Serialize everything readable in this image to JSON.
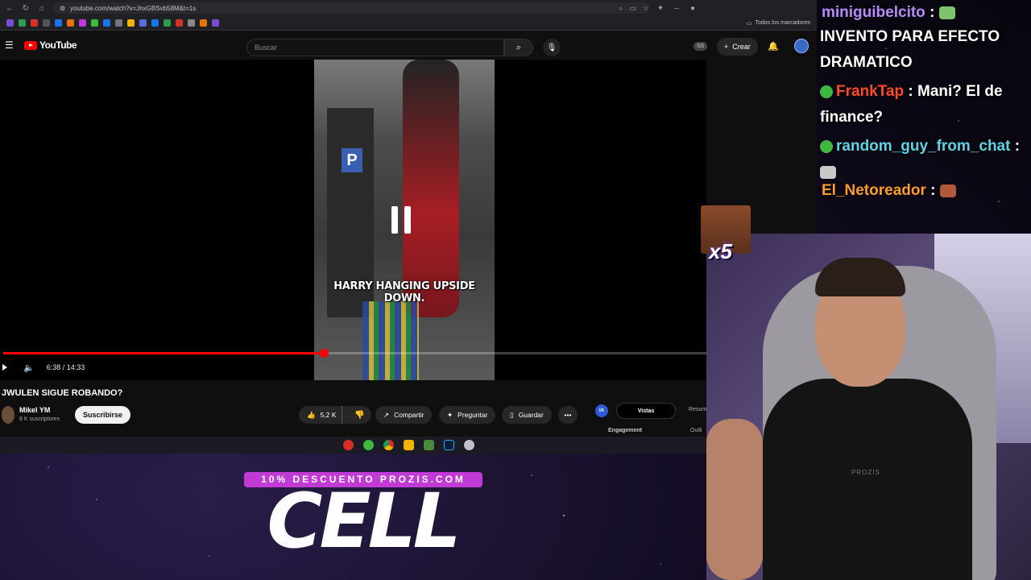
{
  "browser": {
    "url": "youtube.com/watch?v=JnxGBSvb58M&t=1s",
    "bookmarks_folder": "Todos los marcadores"
  },
  "youtube": {
    "logo_text": "YouTube",
    "search_placeholder": "Buscar",
    "ss_badge": "SS",
    "create_label": "Crear",
    "video": {
      "subtitle": "HARRY HANGING UPSIDE DOWN.",
      "time": "6:38 / 14:33",
      "progress_fraction": 0.456
    },
    "title": "JWULEN SIGUE ROBANDO?",
    "channel": {
      "name": "Mikel YM",
      "subscribers": "8 K suscriptores",
      "subscribe_label": "Suscribirse"
    },
    "actions": {
      "likes": "5,2 K",
      "share": "Compartir",
      "ask": "Preguntar",
      "save": "Guardar",
      "more": "•••"
    },
    "panel": {
      "ia_label": "IA",
      "tab_views": "Vistas",
      "tab_summary": "Resum",
      "engagement": "Engagement",
      "outline": "Outli"
    }
  },
  "chat": [
    {
      "user": "miniguibelcito",
      "color": "#b98bff",
      "text": ""
    },
    {
      "user": "",
      "color": "#ffffff",
      "text": "INVENTO PARA EFECTO DRAMATICO"
    },
    {
      "user": "FrankTap",
      "color": "#ff4a2a",
      "text": ": Mani? El de finance?"
    },
    {
      "user": "random_guy_from_chat",
      "color": "#5fd4e8",
      "text": ":"
    },
    {
      "user": "El_Netoreador",
      "color": "#ff9c2a",
      "text": ":"
    }
  ],
  "overlay": {
    "reaction_multiplier": "x5",
    "promo": "10% DESCUENTO PROZIS.COM",
    "product": "CELL",
    "shirt_brand": "PROZIS"
  }
}
